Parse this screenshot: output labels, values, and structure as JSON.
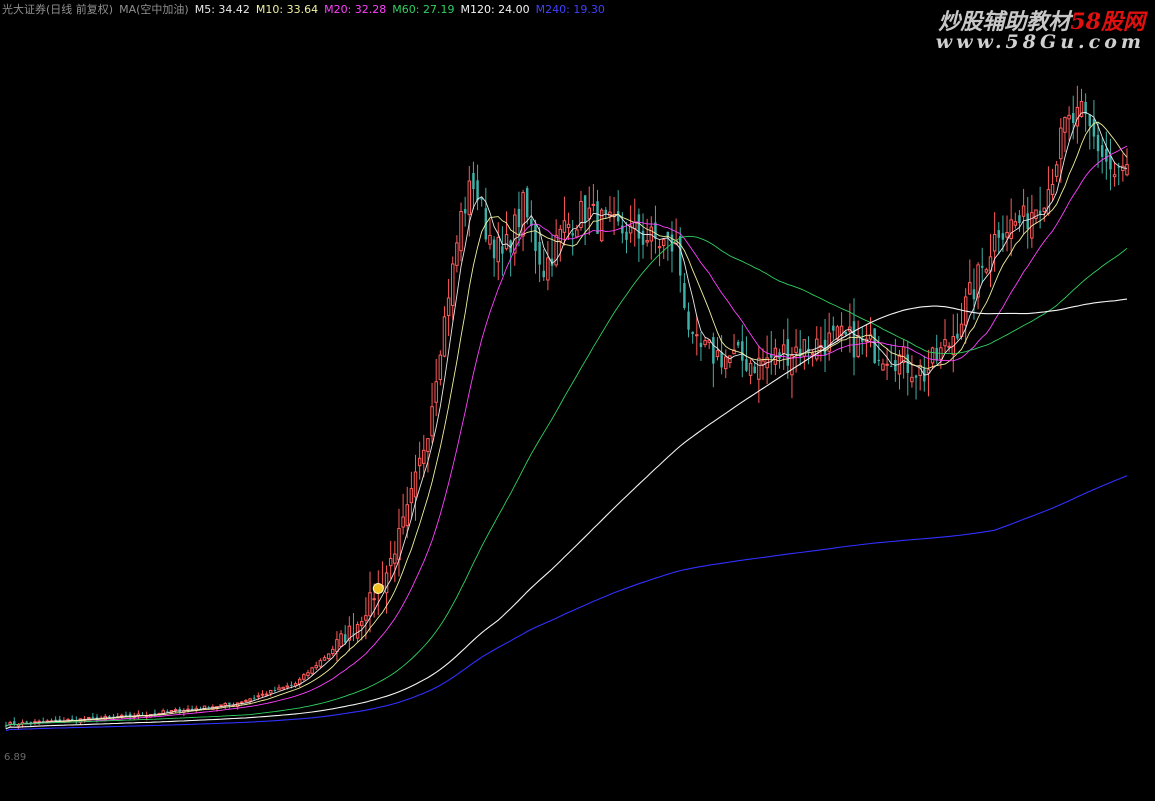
{
  "header": {
    "broker": "光大证券(日线 前复权)",
    "indicator": "MA(空中加油)",
    "ma5_label": "M5: 34.42",
    "ma10_label": "M10: 33.64",
    "ma20_label": "M20: 32.28",
    "ma60_label": "M60: 27.19",
    "ma120_label": "M120: 24.00",
    "ma240_label": "M240: 19.30"
  },
  "watermark": {
    "line1_prefix": "炒股辅助教材",
    "line1_suffix": "58股网",
    "line2": "www.58Gu.com"
  },
  "bottom_label": "6.89",
  "colors": {
    "up": "#ff5a5a",
    "down": "#3fb0a8",
    "m5": "#e8e8e8",
    "m10": "#f0f0a0",
    "m20": "#ff40ff",
    "m60": "#30d060",
    "m120": "#f4f4f4",
    "m240": "#3030ff",
    "text_gray": "#909090"
  },
  "chart_data": {
    "type": "candlestick",
    "title": "",
    "price_range": [
      4.5,
      40.5
    ],
    "note_marker_index": 90,
    "price_path": [
      [
        0,
        7.0
      ],
      [
        30,
        7.4
      ],
      [
        55,
        8.0
      ],
      [
        70,
        9.0
      ],
      [
        78,
        10.5
      ],
      [
        85,
        12.0
      ],
      [
        92,
        14.5
      ],
      [
        97,
        17.5
      ],
      [
        102,
        21.5
      ],
      [
        106,
        27.0
      ],
      [
        110,
        32.0
      ],
      [
        113,
        33.8
      ],
      [
        116,
        31.5
      ],
      [
        120,
        30.0
      ],
      [
        125,
        32.5
      ],
      [
        130,
        29.5
      ],
      [
        135,
        31.5
      ],
      [
        140,
        32.3
      ],
      [
        146,
        31.5
      ],
      [
        155,
        31.0
      ],
      [
        162,
        30.5
      ],
      [
        166,
        25.5
      ],
      [
        172,
        25.2
      ],
      [
        182,
        24.8
      ],
      [
        190,
        25.5
      ],
      [
        202,
        26.0
      ],
      [
        214,
        25.3
      ],
      [
        222,
        24.3
      ],
      [
        228,
        25.8
      ],
      [
        234,
        28.5
      ],
      [
        240,
        31.5
      ],
      [
        246,
        31.8
      ],
      [
        252,
        33.5
      ],
      [
        256,
        36.5
      ],
      [
        260,
        37.0
      ],
      [
        264,
        35.5
      ],
      [
        268,
        34.0
      ],
      [
        271,
        34.4
      ]
    ],
    "series": [
      {
        "name": "M5",
        "value": 34.42
      },
      {
        "name": "M10",
        "value": 33.64
      },
      {
        "name": "M20",
        "value": 32.28
      },
      {
        "name": "M60",
        "value": 27.19
      },
      {
        "name": "M120",
        "value": 24.0
      },
      {
        "name": "M240",
        "value": 19.3
      }
    ]
  }
}
